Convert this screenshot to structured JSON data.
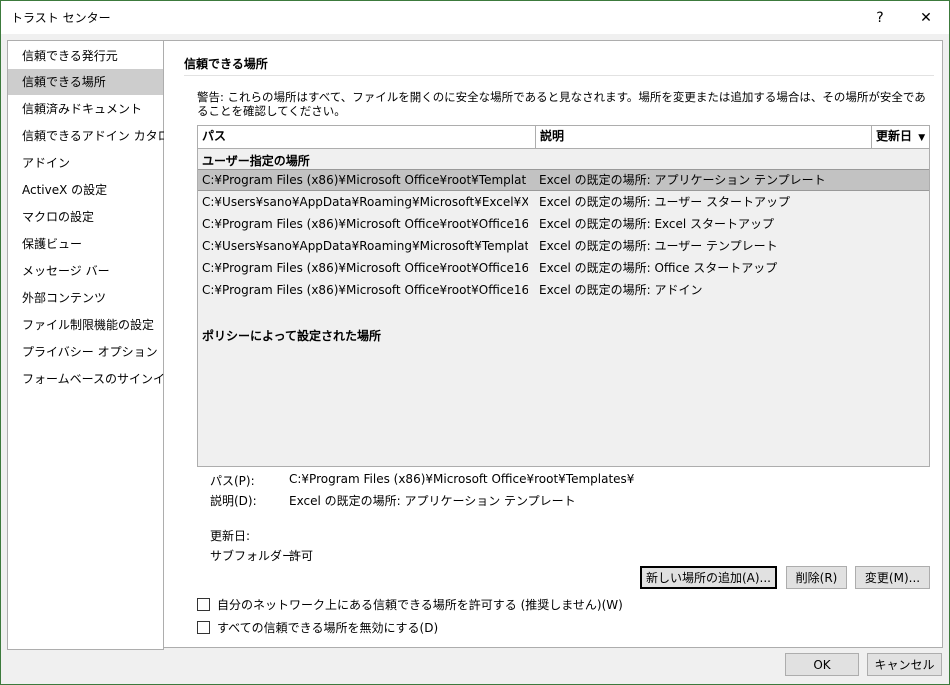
{
  "window": {
    "title": "トラスト センター",
    "help": "?",
    "close": "✕"
  },
  "sidebar": {
    "items": [
      {
        "label": "信頼できる発行元",
        "selected": false
      },
      {
        "label": "信頼できる場所",
        "selected": true
      },
      {
        "label": "信頼済みドキュメント",
        "selected": false
      },
      {
        "label": "信頼できるアドイン カタログ",
        "selected": false
      },
      {
        "label": "アドイン",
        "selected": false
      },
      {
        "label": "ActiveX の設定",
        "selected": false
      },
      {
        "label": "マクロの設定",
        "selected": false
      },
      {
        "label": "保護ビュー",
        "selected": false
      },
      {
        "label": "メッセージ バー",
        "selected": false
      },
      {
        "label": "外部コンテンツ",
        "selected": false
      },
      {
        "label": "ファイル制限機能の設定",
        "selected": false
      },
      {
        "label": "プライバシー オプション",
        "selected": false
      },
      {
        "label": "フォームベースのサインイン",
        "selected": false
      }
    ]
  },
  "main": {
    "title": "信頼できる場所",
    "warning": "警告: これらの場所はすべて、ファイルを開くのに安全な場所であると見なされます。場所を変更または追加する場合は、その場所が安全であることを確認してください。",
    "table": {
      "columns": {
        "path": "パス",
        "description": "説明",
        "date": "更新日",
        "sort_icon": "▼"
      },
      "group_user": "ユーザー指定の場所",
      "group_policy": "ポリシーによって設定された場所",
      "rows": [
        {
          "path": "C:¥Program Files (x86)¥Microsoft Office¥root¥Templat",
          "description": "Excel の既定の場所: アプリケーション テンプレート",
          "selected": true
        },
        {
          "path": "C:¥Users¥sano¥AppData¥Roaming¥Microsoft¥Excel¥X",
          "description": "Excel の既定の場所: ユーザー スタートアップ",
          "selected": false
        },
        {
          "path": "C:¥Program Files (x86)¥Microsoft Office¥root¥Office16",
          "description": "Excel の既定の場所: Excel スタートアップ",
          "selected": false
        },
        {
          "path": "C:¥Users¥sano¥AppData¥Roaming¥Microsoft¥Templat",
          "description": "Excel の既定の場所: ユーザー テンプレート",
          "selected": false
        },
        {
          "path": "C:¥Program Files (x86)¥Microsoft Office¥root¥Office16",
          "description": "Excel の既定の場所: Office スタートアップ",
          "selected": false
        },
        {
          "path": "C:¥Program Files (x86)¥Microsoft Office¥root¥Office16",
          "description": "Excel の既定の場所: アドイン",
          "selected": false
        }
      ]
    },
    "details": {
      "path_label": "パス(P):",
      "path_value": "C:¥Program Files (x86)¥Microsoft Office¥root¥Templates¥",
      "desc_label": "説明(D):",
      "desc_value": "Excel の既定の場所: アプリケーション テンプレート",
      "date_label": "更新日:",
      "date_value": "",
      "subfolder_label": "サブフォルダー:",
      "subfolder_value": "許可"
    },
    "buttons": {
      "add": "新しい場所の追加(A)...",
      "delete": "削除(R)",
      "modify": "変更(M)..."
    },
    "checkboxes": {
      "allow_network": {
        "label": "自分のネットワーク上にある信頼できる場所を許可する (推奨しません)(W)",
        "checked": false
      },
      "disable_all": {
        "label": "すべての信頼できる場所を無効にする(D)",
        "checked": false
      }
    }
  },
  "footer": {
    "ok": "OK",
    "cancel": "キャンセル"
  }
}
